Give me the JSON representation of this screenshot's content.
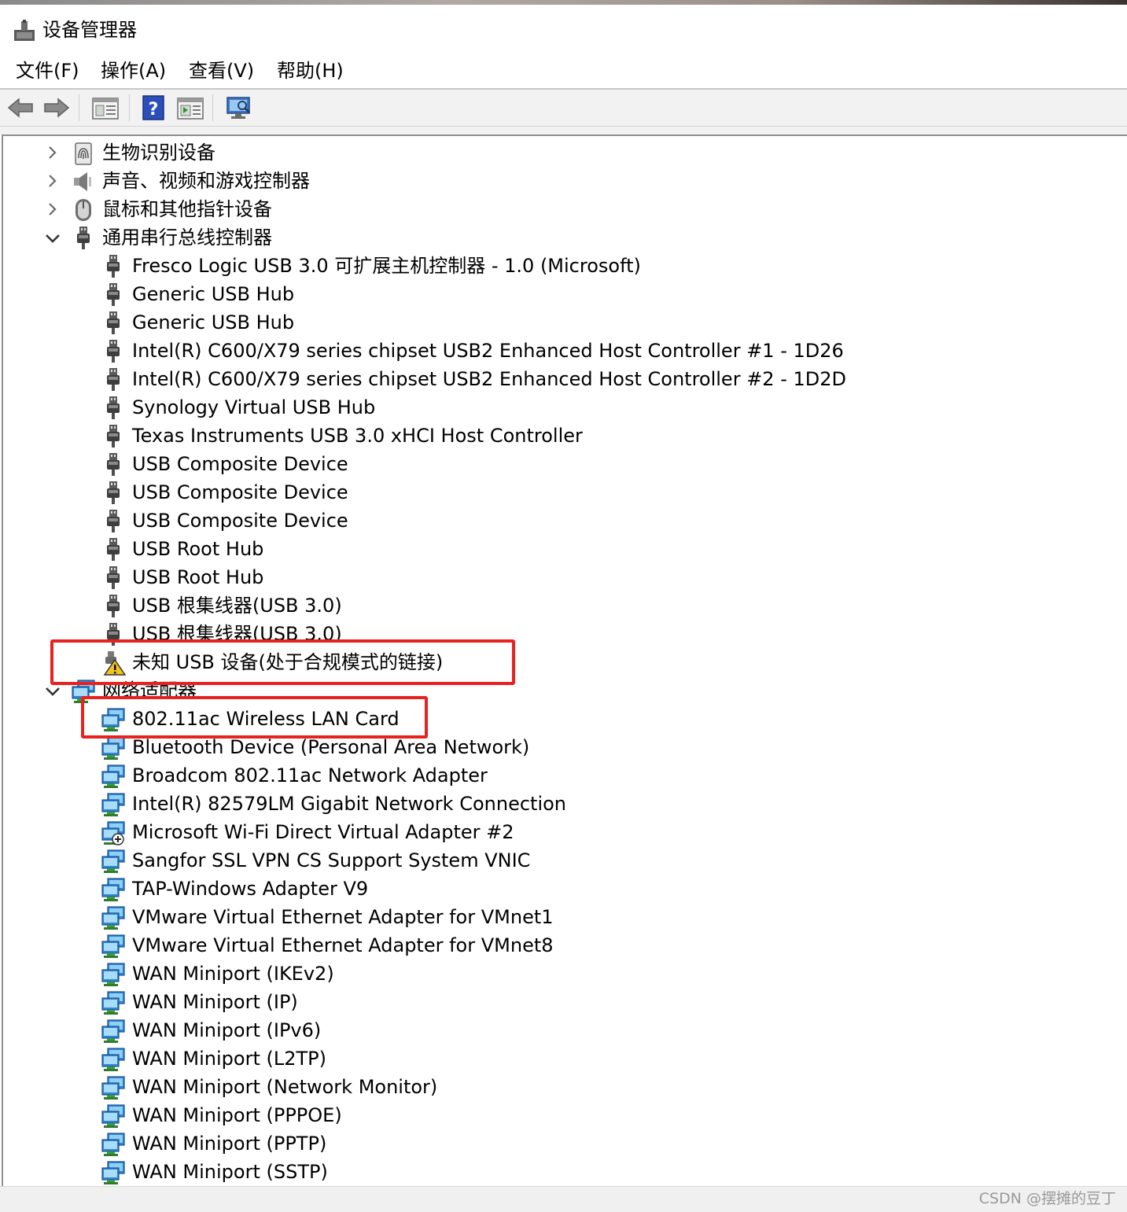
{
  "window": {
    "title": "设备管理器"
  },
  "menu": [
    {
      "label": "文件(F)",
      "name": "menu-file"
    },
    {
      "label": "操作(A)",
      "name": "menu-action"
    },
    {
      "label": "查看(V)",
      "name": "menu-view"
    },
    {
      "label": "帮助(H)",
      "name": "menu-help"
    }
  ],
  "toolbar": {
    "buttons": [
      {
        "name": "back-button",
        "icon": "back-arrow-icon"
      },
      {
        "name": "forward-button",
        "icon": "forward-arrow-icon"
      },
      {
        "name": "show-hide-console-tree-button",
        "icon": "console-tree-icon"
      },
      {
        "name": "help-button",
        "icon": "help-icon"
      },
      {
        "name": "show-action-pane-button",
        "icon": "action-pane-icon"
      },
      {
        "name": "scan-hardware-button",
        "icon": "monitor-scan-icon"
      }
    ]
  },
  "tree": [
    {
      "level": 0,
      "state": "collapsed",
      "icon": "biometric-icon",
      "label": "生物识别设备"
    },
    {
      "level": 0,
      "state": "collapsed",
      "icon": "speaker-icon",
      "label": "声音、视频和游戏控制器"
    },
    {
      "level": 0,
      "state": "collapsed",
      "icon": "mouse-icon",
      "label": "鼠标和其他指针设备"
    },
    {
      "level": 0,
      "state": "expanded",
      "icon": "usb-plug-icon",
      "label": "通用串行总线控制器"
    },
    {
      "level": 1,
      "icon": "usb-plug-icon",
      "label": "Fresco Logic USB 3.0 可扩展主机控制器 - 1.0 (Microsoft)"
    },
    {
      "level": 1,
      "icon": "usb-plug-icon",
      "label": "Generic USB Hub"
    },
    {
      "level": 1,
      "icon": "usb-plug-icon",
      "label": "Generic USB Hub"
    },
    {
      "level": 1,
      "icon": "usb-plug-icon",
      "label": "Intel(R) C600/X79 series chipset USB2 Enhanced Host Controller #1 - 1D26"
    },
    {
      "level": 1,
      "icon": "usb-plug-icon",
      "label": "Intel(R) C600/X79 series chipset USB2 Enhanced Host Controller #2 - 1D2D"
    },
    {
      "level": 1,
      "icon": "usb-plug-icon",
      "label": "Synology Virtual USB Hub"
    },
    {
      "level": 1,
      "icon": "usb-plug-icon",
      "label": "Texas Instruments USB 3.0 xHCI Host Controller"
    },
    {
      "level": 1,
      "icon": "usb-plug-icon",
      "label": "USB Composite Device"
    },
    {
      "level": 1,
      "icon": "usb-plug-icon",
      "label": "USB Composite Device"
    },
    {
      "level": 1,
      "icon": "usb-plug-icon",
      "label": "USB Composite Device"
    },
    {
      "level": 1,
      "icon": "usb-plug-icon",
      "label": "USB Root Hub"
    },
    {
      "level": 1,
      "icon": "usb-plug-icon",
      "label": "USB Root Hub"
    },
    {
      "level": 1,
      "icon": "usb-plug-icon",
      "label": "USB 根集线器(USB 3.0)"
    },
    {
      "level": 1,
      "icon": "usb-plug-icon",
      "label": "USB 根集线器(USB 3.0)"
    },
    {
      "level": 1,
      "icon": "usb-warning-icon",
      "label": "未知 USB 设备(处于合规模式的链接)"
    },
    {
      "level": 0,
      "state": "expanded",
      "icon": "network-adapter-icon",
      "label": "网络适配器"
    },
    {
      "level": 1,
      "icon": "network-adapter-icon",
      "label": "802.11ac Wireless LAN Card"
    },
    {
      "level": 1,
      "icon": "network-adapter-icon",
      "label": "Bluetooth Device (Personal Area Network)"
    },
    {
      "level": 1,
      "icon": "network-adapter-icon",
      "label": "Broadcom 802.11ac Network Adapter"
    },
    {
      "level": 1,
      "icon": "network-adapter-icon",
      "label": "Intel(R) 82579LM Gigabit Network Connection"
    },
    {
      "level": 1,
      "icon": "network-adapter-disabled-icon",
      "label": "Microsoft Wi-Fi Direct Virtual Adapter #2"
    },
    {
      "level": 1,
      "icon": "network-adapter-icon",
      "label": "Sangfor SSL VPN CS Support System VNIC"
    },
    {
      "level": 1,
      "icon": "network-adapter-icon",
      "label": "TAP-Windows Adapter V9"
    },
    {
      "level": 1,
      "icon": "network-adapter-icon",
      "label": "VMware Virtual Ethernet Adapter for VMnet1"
    },
    {
      "level": 1,
      "icon": "network-adapter-icon",
      "label": "VMware Virtual Ethernet Adapter for VMnet8"
    },
    {
      "level": 1,
      "icon": "network-adapter-icon",
      "label": "WAN Miniport (IKEv2)"
    },
    {
      "level": 1,
      "icon": "network-adapter-icon",
      "label": "WAN Miniport (IP)"
    },
    {
      "level": 1,
      "icon": "network-adapter-icon",
      "label": "WAN Miniport (IPv6)"
    },
    {
      "level": 1,
      "icon": "network-adapter-icon",
      "label": "WAN Miniport (L2TP)"
    },
    {
      "level": 1,
      "icon": "network-adapter-icon",
      "label": "WAN Miniport (Network Monitor)"
    },
    {
      "level": 1,
      "icon": "network-adapter-icon",
      "label": "WAN Miniport (PPPOE)"
    },
    {
      "level": 1,
      "icon": "network-adapter-icon",
      "label": "WAN Miniport (PPTP)"
    },
    {
      "level": 1,
      "icon": "network-adapter-icon",
      "label": "WAN Miniport (SSTP)"
    }
  ],
  "annotations": {
    "highlight_color": "#e8221e",
    "highlighted_items": [
      "未知 USB 设备(处于合规模式的链接)",
      "802.11ac Wireless LAN Card"
    ]
  },
  "watermark": "CSDN @摆摊的豆丁"
}
